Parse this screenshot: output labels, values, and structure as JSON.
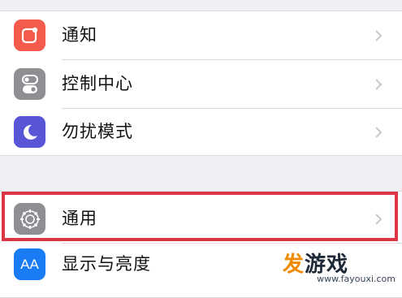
{
  "settings_group_1": {
    "items": [
      {
        "label": "通知",
        "icon": "notifications-icon",
        "color": "#f35b4d"
      },
      {
        "label": "控制中心",
        "icon": "control-center-icon",
        "color": "#8e8e93"
      },
      {
        "label": "勿扰模式",
        "icon": "moon-icon",
        "color": "#5856d6"
      }
    ]
  },
  "settings_group_2": {
    "items": [
      {
        "label": "通用",
        "icon": "gear-icon",
        "color": "#8e8e93",
        "highlighted": true
      },
      {
        "label": "显示与亮度",
        "icon": "display-icon",
        "color": "#1a7cf5"
      }
    ]
  },
  "display_icon_text": "AA",
  "watermark": {
    "brand_accent": "发",
    "brand_rest": "游戏",
    "url": "www.fayouxi.com"
  },
  "colors": {
    "highlight_border": "#dc3545",
    "background": "#efeff4",
    "chevron": "#c7c7cc"
  }
}
